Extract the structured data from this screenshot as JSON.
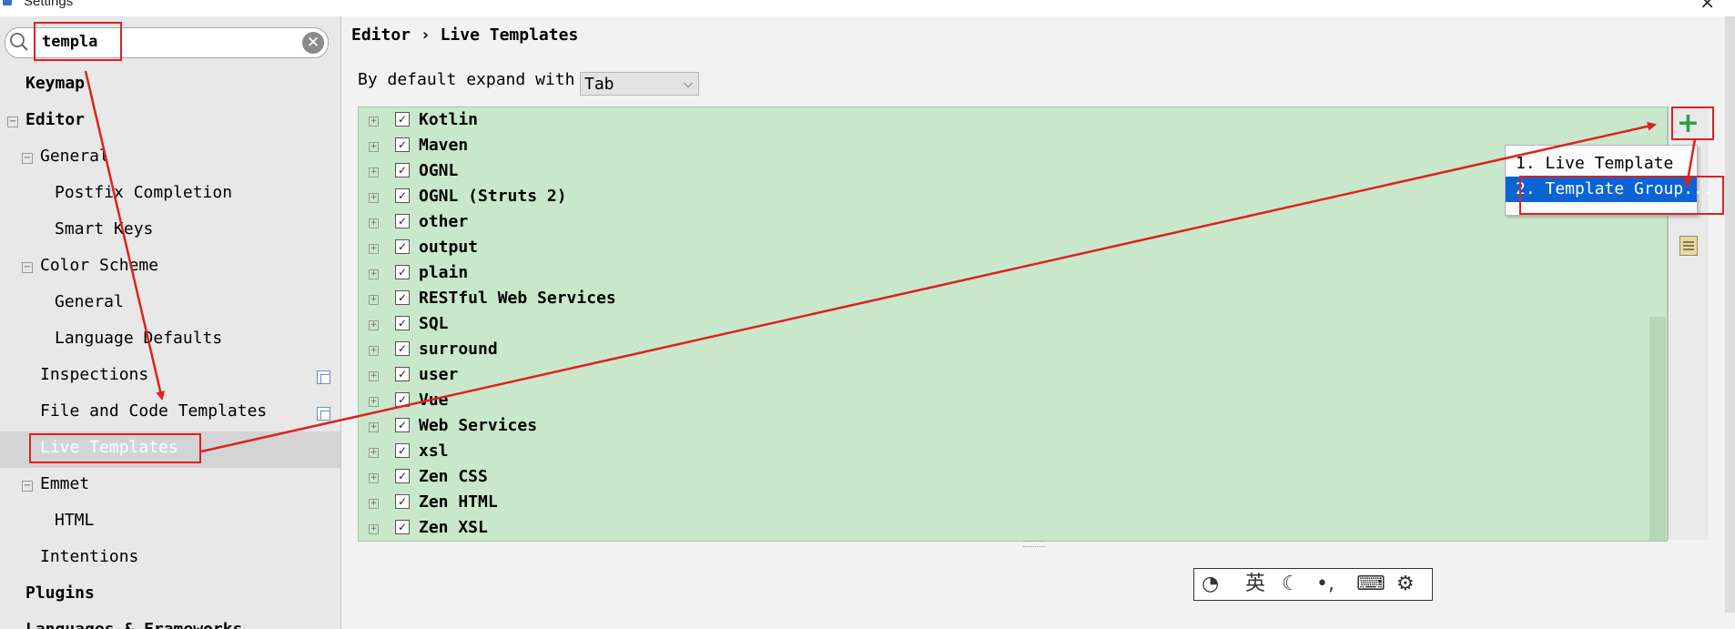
{
  "window": {
    "title": "Settings"
  },
  "search": {
    "value": "templa"
  },
  "sidebar": {
    "items": [
      {
        "label": "Keymap"
      },
      {
        "label": "Editor"
      },
      {
        "label": "General"
      },
      {
        "label": "Postfix Completion"
      },
      {
        "label": "Smart Keys"
      },
      {
        "label": "Color Scheme"
      },
      {
        "label": "General"
      },
      {
        "label": "Language Defaults"
      },
      {
        "label": "Inspections"
      },
      {
        "label": "File and Code Templates"
      },
      {
        "label": "Live Templates"
      },
      {
        "label": "Emmet"
      },
      {
        "label": "HTML"
      },
      {
        "label": "Intentions"
      },
      {
        "label": "Plugins"
      },
      {
        "label": "Languages & Frameworks"
      }
    ]
  },
  "breadcrumb": {
    "parent": "Editor",
    "separator": "›",
    "current": "Live Templates"
  },
  "expand": {
    "label": "By default expand with",
    "value": "Tab"
  },
  "groups": [
    {
      "name": "Kotlin"
    },
    {
      "name": "Maven"
    },
    {
      "name": "OGNL"
    },
    {
      "name": "OGNL (Struts 2)"
    },
    {
      "name": "other"
    },
    {
      "name": "output"
    },
    {
      "name": "plain"
    },
    {
      "name": "RESTful Web Services"
    },
    {
      "name": "SQL"
    },
    {
      "name": "surround"
    },
    {
      "name": "user"
    },
    {
      "name": "Vue"
    },
    {
      "name": "Web Services"
    },
    {
      "name": "xsl"
    },
    {
      "name": "Zen CSS"
    },
    {
      "name": "Zen HTML"
    },
    {
      "name": "Zen XSL"
    }
  ],
  "toolbar": {
    "add_icon": "plus-icon",
    "add_symbol": "+"
  },
  "add_menu": {
    "options": [
      {
        "label": "1. Live Template"
      },
      {
        "label": "2. Template Group..."
      }
    ]
  },
  "ime_toolbar": {
    "english_mode": "英",
    "punctuation": "•,",
    "icons": [
      "ime-logo-icon",
      "chinese-english-toggle-icon",
      "moon-icon",
      "punctuation-icon",
      "keyboard-icon",
      "gear-icon"
    ]
  },
  "colors": {
    "list_background": "#c9e8cb",
    "selection_blue": "#0a64d6",
    "annotation_red": "#e02020",
    "add_green": "#2e9e3e"
  }
}
